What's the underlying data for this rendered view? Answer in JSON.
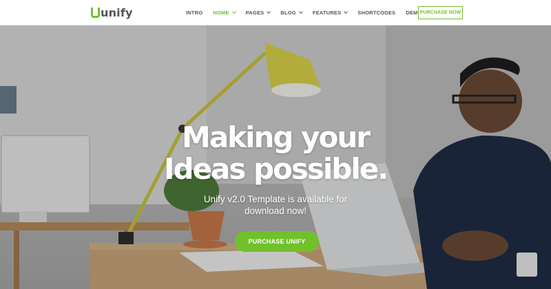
{
  "brand": {
    "name": "unify",
    "accent": "#72c02c"
  },
  "nav": {
    "items": [
      {
        "label": "INTRO",
        "dropdown": false,
        "active": false
      },
      {
        "label": "HOME",
        "dropdown": true,
        "active": true
      },
      {
        "label": "PAGES",
        "dropdown": true,
        "active": false
      },
      {
        "label": "BLOG",
        "dropdown": true,
        "active": false
      },
      {
        "label": "FEATURES",
        "dropdown": true,
        "active": false
      },
      {
        "label": "SHORTCODES",
        "dropdown": false,
        "active": false
      },
      {
        "label": "DEMOS",
        "dropdown": true,
        "active": false
      }
    ],
    "purchase_label": "PURCHASE NOW"
  },
  "hero": {
    "headline_line1": "Making your",
    "headline_line2": "Ideas possible.",
    "subtitle_line1": "Unify v2.0 Template is available for",
    "subtitle_line2": "download now!",
    "cta_label": "PURCHASE UNIFY",
    "background": "photo-man-at-desk-with-laptop-and-lamp"
  }
}
